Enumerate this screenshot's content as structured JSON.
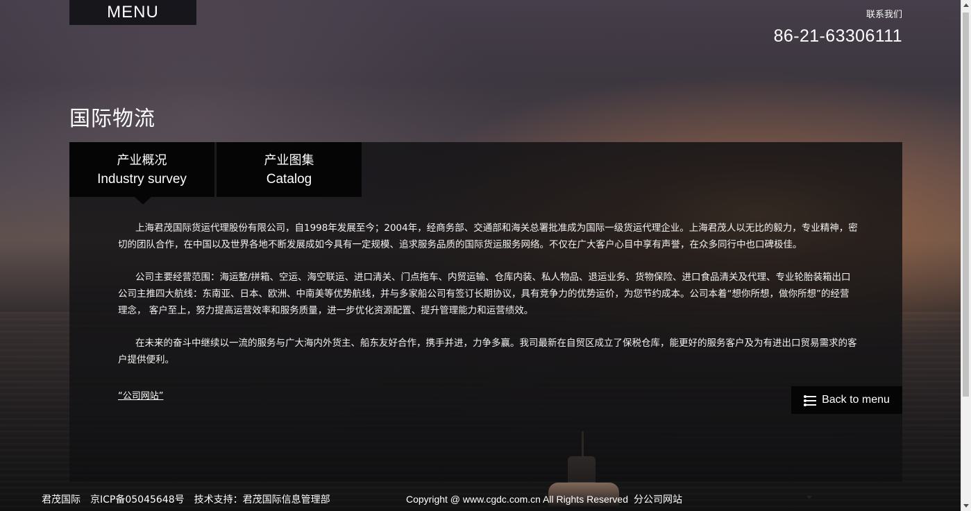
{
  "header": {
    "menu_label": "MENU",
    "contact_label": "联系我们",
    "phone": "86-21-63306111"
  },
  "page": {
    "title": "国际物流"
  },
  "tabs": [
    {
      "label_cn": "产业概况",
      "label_en": "Industry survey",
      "active": true
    },
    {
      "label_cn": "产业图集",
      "label_en": "Catalog",
      "active": false
    }
  ],
  "content": {
    "paragraphs": [
      "上海君茂国际货运代理股份有限公司，自1998年发展至今；2004年，经商务部、交通部和海关总署批准成为国际一级货运代理企业。上海君茂人以无比的毅力，专业精神，密切的团队合作，在中国以及世界各地不断发展成如今具有一定规模、追求服务品质的国际货运服务网络。不仅在广大客户心目中享有声誉，在众多同行中也口碑极佳。",
      "公司主要经营范围：海运整/拼箱、空运、海空联运、进口清关、门点拖车、内贸运输、仓库内装、私人物品、退运业务、货物保险、进口食品清关及代理、专业轮胎装箱出口 公司主推四大航线：东南亚、日本、欧洲、中南美等优势航线，并与多家船公司有签订长期协议，具有竞争力的优势运价，为您节约成本。公司本着“想你所想，做你所想”的经营理念， 客户至上，努力提高运营效率和服务质量，进一步优化资源配置、提升管理能力和运营绩效。",
      "在未来的奋斗中继续以一流的服务与广大海内外货主、船东友好合作，携手并进，力争多赢。我司最新在自贸区成立了保税仓库，能更好的服务客户及为有进出口贸易需求的客户提供便利。"
    ],
    "site_link": "“公司网站”"
  },
  "actions": {
    "back_to_menu": "Back to menu"
  },
  "footer": {
    "left_items": [
      "君茂国际",
      "京ICP备05045648号",
      "技术支持：君茂国际信息管理部"
    ],
    "copyright": "Copyright @ www.cgdc.com.cn All Rights Reserved",
    "branch_label": "分公司网站"
  },
  "icons": {
    "back_icon": "list-icon",
    "dropdown_icon": "chevron-down-icon",
    "scroll_up": "scroll-up-icon",
    "scroll_down": "scroll-down-icon"
  }
}
